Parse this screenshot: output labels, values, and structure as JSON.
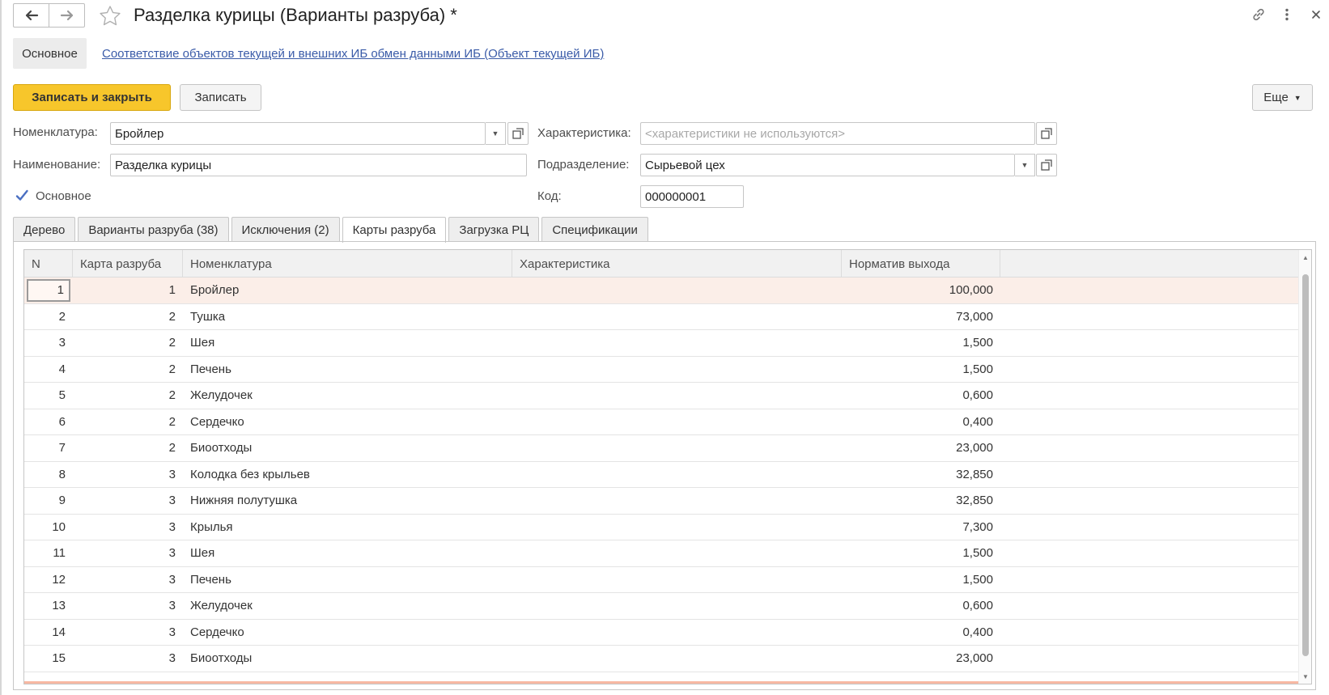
{
  "window": {
    "title": "Разделка курицы (Варианты разруба) *"
  },
  "sections": {
    "main": "Основное",
    "link": "Соответствие объектов текущей и внешних ИБ обмен данными ИБ (Объект текущей ИБ)"
  },
  "toolbar": {
    "save_close": "Записать и закрыть",
    "save": "Записать",
    "more": "Еще"
  },
  "form": {
    "nomenclature_label": "Номенклатура:",
    "nomenclature_value": "Бройлер",
    "name_label": "Наименование:",
    "name_value": "Разделка курицы",
    "characteristic_label": "Характеристика:",
    "characteristic_placeholder": "<характеристики не используются>",
    "department_label": "Подразделение:",
    "department_value": "Сырьевой цех",
    "code_label": "Код:",
    "code_value": "000000001",
    "main_checkbox_label": "Основное",
    "main_checked": true
  },
  "tabs": [
    {
      "label": "Дерево",
      "active": false
    },
    {
      "label": "Варианты разруба (38)",
      "active": false
    },
    {
      "label": "Исключения (2)",
      "active": false
    },
    {
      "label": "Карты разруба",
      "active": true
    },
    {
      "label": "Загрузка РЦ",
      "active": false
    },
    {
      "label": "Спецификации",
      "active": false
    }
  ],
  "table": {
    "columns": [
      "N",
      "Карта разруба",
      "Номенклатура",
      "Характеристика",
      "Норматив выхода"
    ],
    "rows": [
      {
        "n": "1",
        "card": "1",
        "nomenclature": "Бройлер",
        "characteristic": "",
        "norm": "100,000"
      },
      {
        "n": "2",
        "card": "2",
        "nomenclature": "Тушка",
        "characteristic": "",
        "norm": "73,000"
      },
      {
        "n": "3",
        "card": "2",
        "nomenclature": "Шея",
        "characteristic": "",
        "norm": "1,500"
      },
      {
        "n": "4",
        "card": "2",
        "nomenclature": "Печень",
        "characteristic": "",
        "norm": "1,500"
      },
      {
        "n": "5",
        "card": "2",
        "nomenclature": "Желудочек",
        "characteristic": "",
        "norm": "0,600"
      },
      {
        "n": "6",
        "card": "2",
        "nomenclature": "Сердечко",
        "characteristic": "",
        "norm": "0,400"
      },
      {
        "n": "7",
        "card": "2",
        "nomenclature": "Биоотходы",
        "characteristic": "",
        "norm": "23,000"
      },
      {
        "n": "8",
        "card": "3",
        "nomenclature": "Колодка без крыльев",
        "characteristic": "",
        "norm": "32,850"
      },
      {
        "n": "9",
        "card": "3",
        "nomenclature": "Нижняя полутушка",
        "characteristic": "",
        "norm": "32,850"
      },
      {
        "n": "10",
        "card": "3",
        "nomenclature": "Крылья",
        "characteristic": "",
        "norm": "7,300"
      },
      {
        "n": "11",
        "card": "3",
        "nomenclature": "Шея",
        "characteristic": "",
        "norm": "1,500"
      },
      {
        "n": "12",
        "card": "3",
        "nomenclature": "Печень",
        "characteristic": "",
        "norm": "1,500"
      },
      {
        "n": "13",
        "card": "3",
        "nomenclature": "Желудочек",
        "characteristic": "",
        "norm": "0,600"
      },
      {
        "n": "14",
        "card": "3",
        "nomenclature": "Сердечко",
        "characteristic": "",
        "norm": "0,400"
      },
      {
        "n": "15",
        "card": "3",
        "nomenclature": "Биоотходы",
        "characteristic": "",
        "norm": "23,000"
      }
    ],
    "selected_row": 0
  },
  "colors": {
    "accent_button": "#f7c62b",
    "link": "#3a5ba8",
    "selected_row": "#fbeee8"
  },
  "icons": {
    "back": "arrow-left-icon",
    "forward": "arrow-right-icon",
    "favorite": "star-icon",
    "link": "link-icon",
    "menu": "more-vertical-icon",
    "close": "close-icon"
  }
}
